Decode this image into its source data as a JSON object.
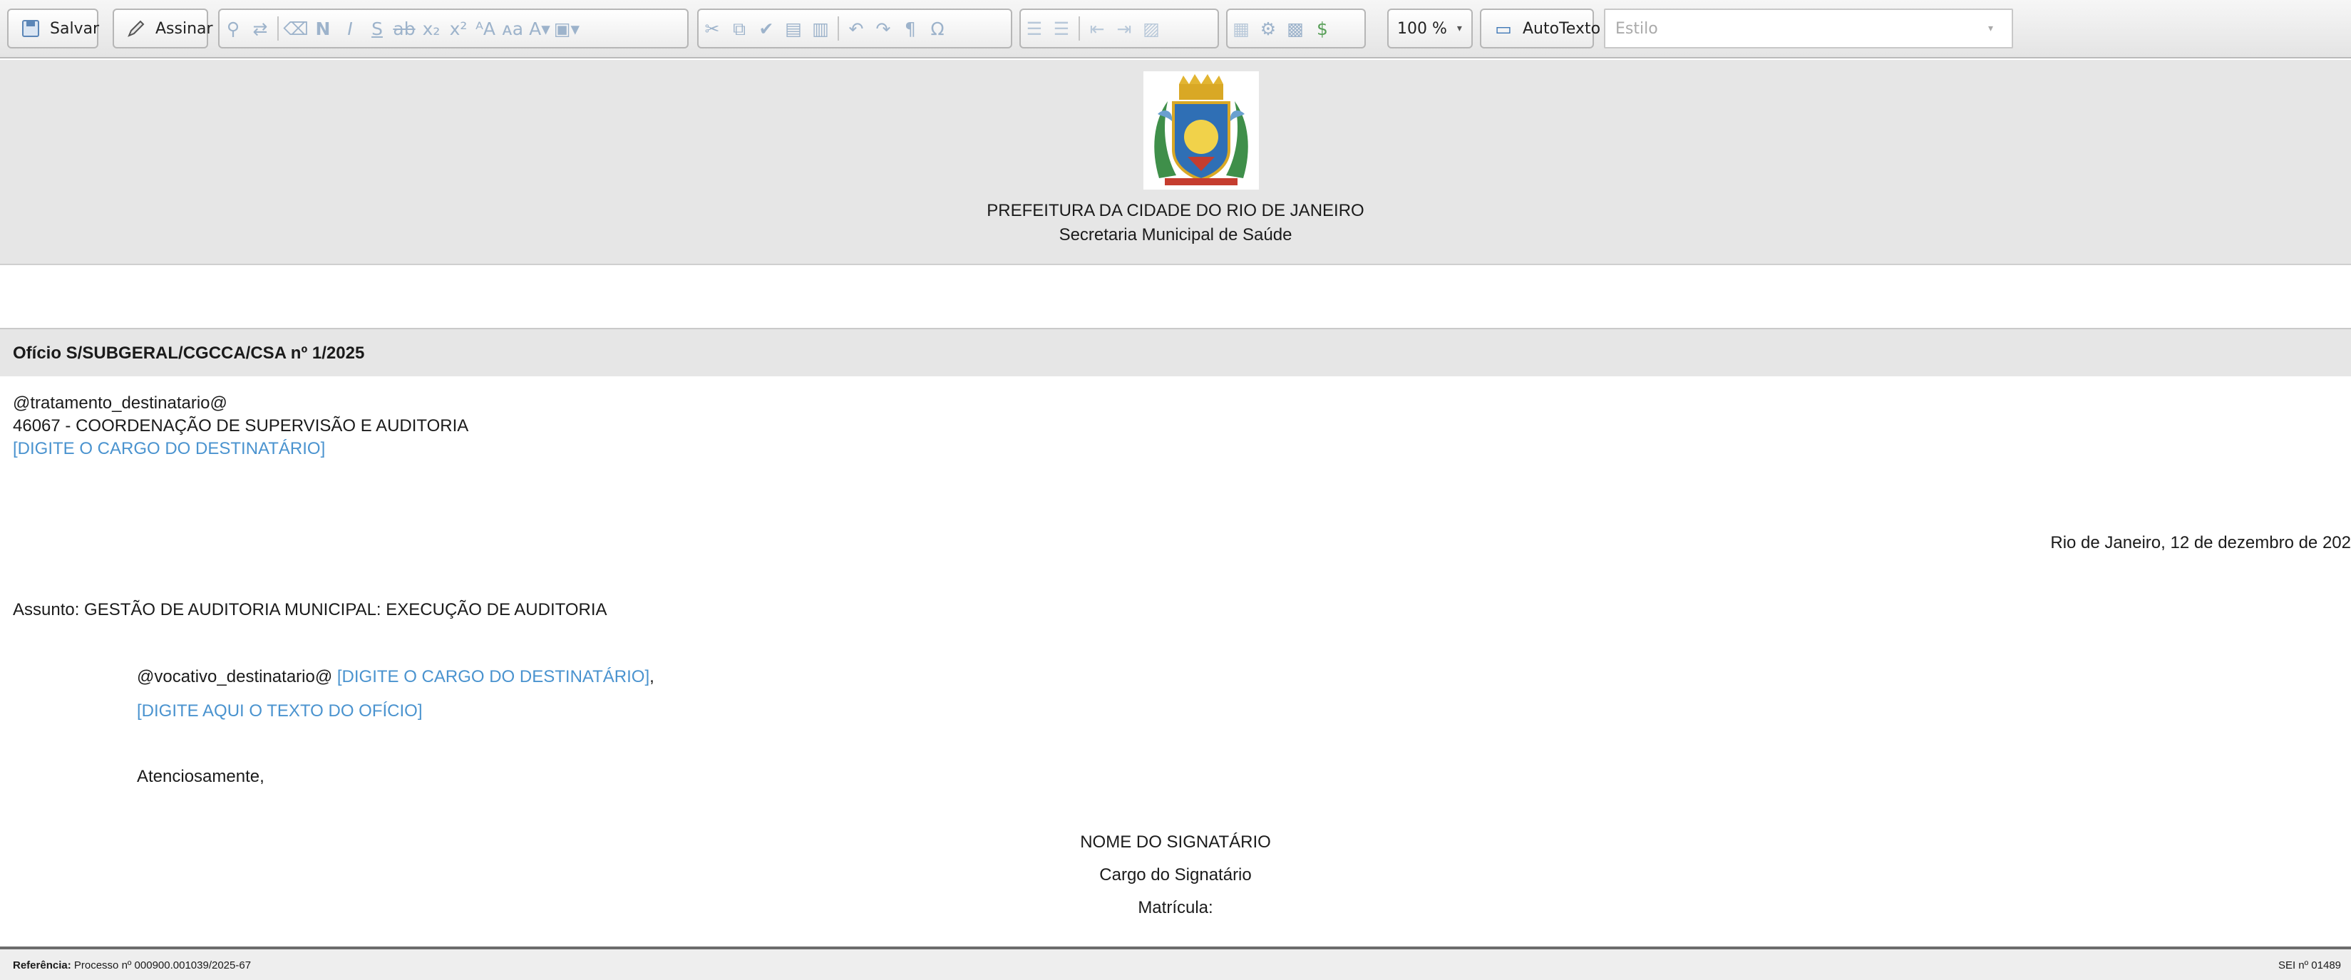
{
  "toolbar": {
    "save_label": "Salvar",
    "sign_label": "Assinar",
    "format_bold": "N",
    "format_italic": "I",
    "format_underline": "S",
    "zoom_value": "100 %",
    "autotext_label": "AutoTexto",
    "style_placeholder": "Estilo",
    "icons": [
      "save-icon",
      "pen-icon",
      "find-icon",
      "replace-icon",
      "eraser-icon",
      "bold-icon",
      "italic-icon",
      "underline-icon",
      "strike-icon",
      "subscript-icon",
      "superscript-icon",
      "uppercase-icon",
      "lowercase-icon",
      "text-color-icon",
      "bg-color-icon",
      "cut-icon",
      "copy-icon",
      "format-painter-icon",
      "paste-text-icon",
      "paste-word-icon",
      "undo-icon",
      "redo-icon",
      "pilcrow-icon",
      "omega-icon",
      "numbered-list-icon",
      "bullet-list-icon",
      "outdent-icon",
      "indent-icon",
      "image-icon",
      "table-icon",
      "spellcheck-icon",
      "grid-icon",
      "currency-icon",
      "chat-icon"
    ]
  },
  "header": {
    "line1": "PREFEITURA DA CIDADE DO RIO DE JANEIRO",
    "line2": "Secretaria Municipal de Saúde"
  },
  "document": {
    "title": "Ofício S/SUBGERAL/CGCCA/CSA nº 1/2025",
    "recipient_treatment": "@tratamento_destinatario@",
    "recipient_unit": "46067 - COORDENAÇÃO DE SUPERVISÃO E AUDITORIA",
    "recipient_role_placeholder": "[DIGITE O CARGO DO DESTINATÁRIO]",
    "place_date": "Rio de Janeiro, 12 de dezembro de 202",
    "subject": "Assunto: GESTÃO DE AUDITORIA MUNICIPAL: EXECUÇÃO DE AUDITORIA",
    "vocative": "@vocativo_destinatario@",
    "vocative_role": "[DIGITE O CARGO DO DESTINATÁRIO]",
    "vocative_comma": ",",
    "body_placeholder": "[DIGITE AQUI O TEXTO DO OFÍCIO]",
    "closing": "Atenciosamente,",
    "signer_name": "NOME DO SIGNATÁRIO",
    "signer_role": "Cargo do Signatário",
    "signer_registration": "Matrícula:"
  },
  "footer": {
    "reference_label": "Referência:",
    "reference_value": " Processo nº 000900.001039/2025-67",
    "sei_number": "SEI nº 01489"
  },
  "colors": {
    "placeholder_blue": "#4a93cf",
    "band_gray": "#e6e6e6",
    "toolbar_gray": "#e4e4e4"
  }
}
